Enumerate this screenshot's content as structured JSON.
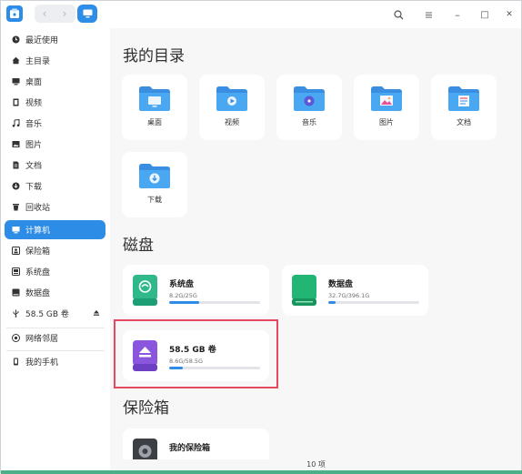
{
  "titlebar": {
    "nav_back": "‹",
    "nav_forward": "›",
    "search_icon": "search-icon",
    "menu_icon": "menu-icon",
    "minimize": "–",
    "maximize": "□",
    "close": "✕"
  },
  "sidebar": {
    "items": [
      {
        "label": "最近使用",
        "icon": "clock-icon"
      },
      {
        "label": "主目录",
        "icon": "home-icon"
      },
      {
        "label": "桌面",
        "icon": "desktop-icon"
      },
      {
        "label": "视频",
        "icon": "video-icon"
      },
      {
        "label": "音乐",
        "icon": "music-icon"
      },
      {
        "label": "图片",
        "icon": "picture-icon"
      },
      {
        "label": "文档",
        "icon": "document-icon"
      },
      {
        "label": "下载",
        "icon": "download-icon"
      },
      {
        "label": "回收站",
        "icon": "trash-icon"
      },
      {
        "label": "计算机",
        "icon": "computer-icon",
        "active": true
      },
      {
        "label": "保险箱",
        "icon": "vault-icon"
      },
      {
        "label": "系统盘",
        "icon": "disk-icon"
      },
      {
        "label": "数据盘",
        "icon": "disk-icon"
      },
      {
        "label": "58.5 GB 卷",
        "icon": "usb-icon"
      },
      {
        "label": "网络邻居",
        "icon": "network-icon"
      },
      {
        "label": "我的手机",
        "icon": "phone-icon"
      }
    ]
  },
  "main": {
    "my_dirs_title": "我的目录",
    "dirs": [
      {
        "label": "桌面",
        "icon": "desktop-folder-icon"
      },
      {
        "label": "视频",
        "icon": "video-folder-icon"
      },
      {
        "label": "音乐",
        "icon": "music-folder-icon"
      },
      {
        "label": "图片",
        "icon": "picture-folder-icon"
      },
      {
        "label": "文档",
        "icon": "document-folder-icon"
      },
      {
        "label": "下载",
        "icon": "download-folder-icon"
      }
    ],
    "disks_title": "磁盘",
    "disks": [
      {
        "name": "系统盘",
        "size": "8.2G/25G",
        "used_fraction": 0.33,
        "color": "#2fb98a"
      },
      {
        "name": "数据盘",
        "size": "32.7G/396.1G",
        "used_fraction": 0.08,
        "color": "#22b573"
      },
      {
        "name": "58.5 GB 卷",
        "size": "8.6G/58.5G",
        "used_fraction": 0.15,
        "color": "#8a56dd"
      }
    ],
    "vault_title": "保险箱",
    "vault_item": "我的保险箱"
  },
  "status": {
    "count": "10 项"
  },
  "colors": {
    "accent": "#2d8ce6",
    "highlight": "#e5495f"
  }
}
